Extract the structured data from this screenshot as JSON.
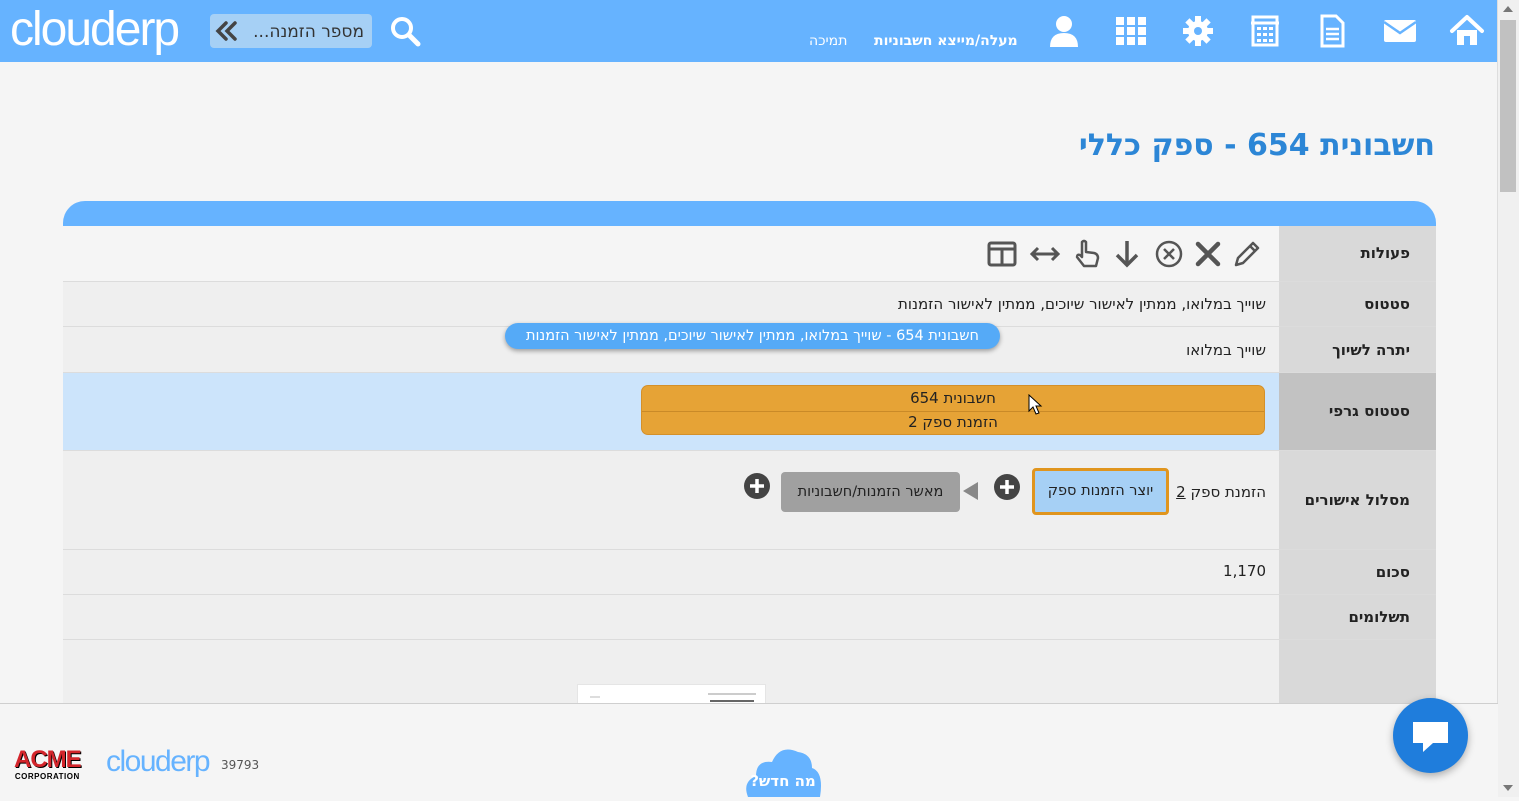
{
  "topbar": {
    "logo": "clouderp",
    "search_placeholder": "מספר הזמנה...",
    "links": {
      "support": "תמיכה",
      "upload_invoices": "מעלה/מייצא חשבוניות"
    },
    "icons": [
      "home-icon",
      "mail-icon",
      "document-icon",
      "calculator-icon",
      "gear-icon",
      "apps-grid-icon",
      "user-icon",
      "search-icon",
      "double-chevron-left-icon"
    ]
  },
  "page": {
    "title": "חשבונית 654 - ספק כללי"
  },
  "rows": {
    "actions_label": "פעולות",
    "status_label": "סטטוס",
    "status_value": "שוייך במלואו, ממתין לאישור שיוכים, ממתין לאישור הזמנות",
    "balance_label": "יתרה לשיוך",
    "balance_value": "שוייך במלואו",
    "tooltip": "חשבונית 654 - שוייך במלואו, ממתין לאישור שיוכים, ממתין לאישור הזמנות",
    "graphic_label": "סטטוס גרפי",
    "graphic_line1": "חשבונית 654",
    "graphic_line2": "הזמנת ספק 2",
    "approval_label": "מסלול אישורים",
    "approval_order_prefix": "הזמנת ספק",
    "approval_order_num": "2",
    "approval_step1": "יוצר הזמנות ספק",
    "approval_step2": "מאשר הזמנות/חשבוניות",
    "sum_label": "סכום",
    "sum_value": "1,170",
    "payments_label": "תשלומים"
  },
  "footer": {
    "acme_big": "ACME",
    "acme_small": "CORPORATION",
    "logo": "clouderp",
    "number": "39793",
    "whats_new": "מה חדש?"
  },
  "colors": {
    "topbar": "#66b3ff",
    "title": "#2c86d6",
    "graphic_bar": "#e6a336",
    "highlight_row": "#cce4fb",
    "chat": "#1f7ddc"
  }
}
